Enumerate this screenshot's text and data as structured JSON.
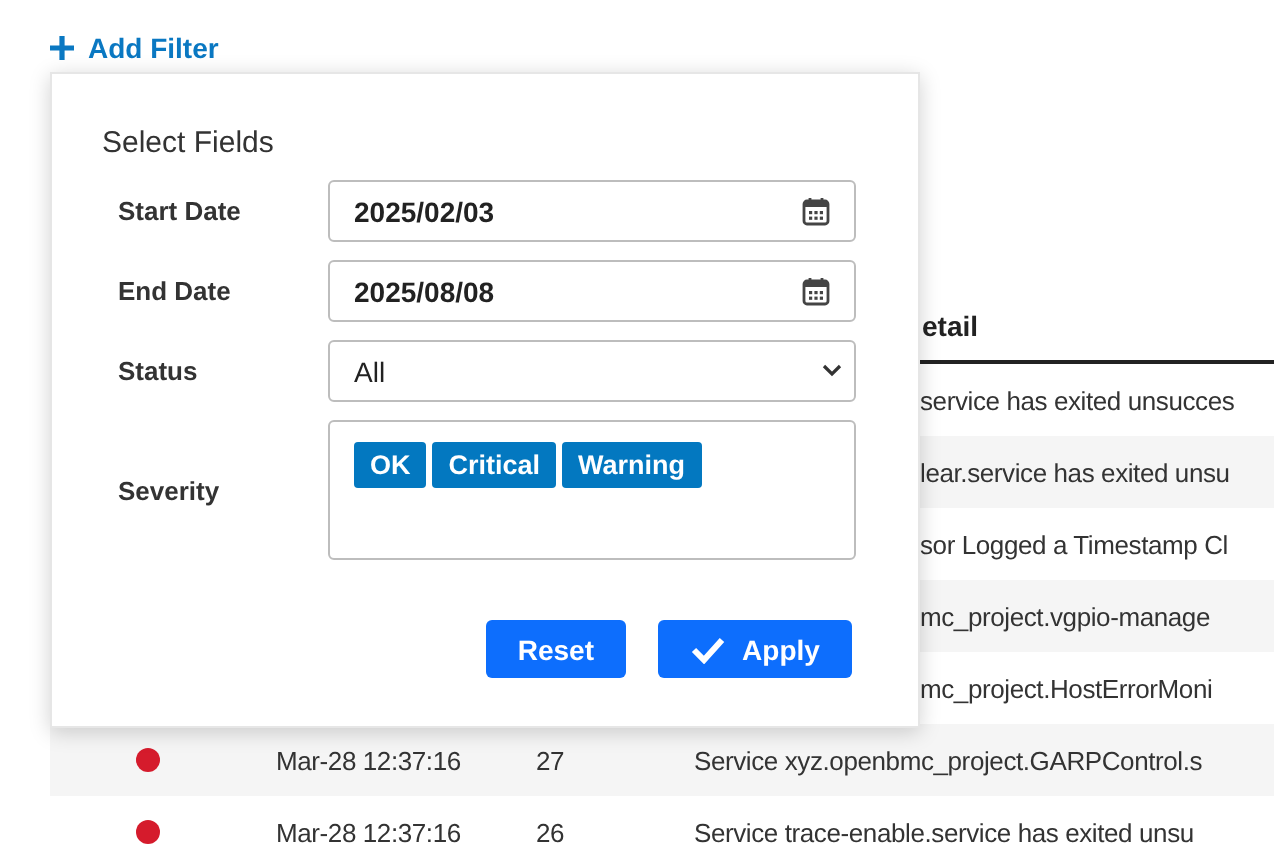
{
  "add_filter": {
    "label": "Add Filter"
  },
  "filter_panel": {
    "title": "Select Fields",
    "fields": [
      {
        "kind": "date",
        "label": "Start Date",
        "value": "2025/02/03"
      },
      {
        "kind": "date",
        "label": "End Date",
        "value": "2025/08/08"
      },
      {
        "kind": "select",
        "label": "Status",
        "value": "All"
      },
      {
        "kind": "tags",
        "label": "Severity",
        "tags": [
          "OK",
          "Critical",
          "Warning"
        ]
      }
    ],
    "buttons": [
      {
        "kind": "reset",
        "label": "Reset"
      },
      {
        "kind": "apply",
        "label": "Apply"
      }
    ]
  },
  "table": {
    "detail_header": "etail",
    "rows": [
      {
        "covered": true,
        "detail": "service has exited unsucces"
      },
      {
        "covered": true,
        "detail": "lear.service has exited unsu"
      },
      {
        "covered": true,
        "detail": "sor Logged a Timestamp Cl"
      },
      {
        "covered": true,
        "detail": "mc_project.vgpio-manage"
      },
      {
        "covered": true,
        "detail": "mc_project.HostErrorMoni"
      },
      {
        "covered": false,
        "time": "Mar-28 12:37:16",
        "id": "27",
        "detail": "Service xyz.openbmc_project.GARPControl.s"
      },
      {
        "covered": false,
        "time": "Mar-28 12:37:16",
        "id": "26",
        "detail": "Service trace-enable.service has exited unsu"
      }
    ]
  }
}
